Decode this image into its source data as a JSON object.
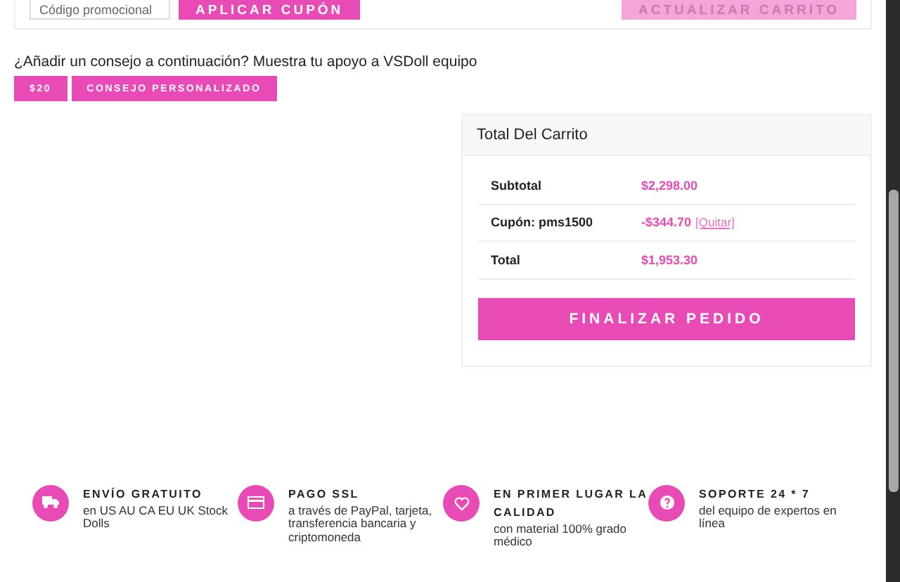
{
  "coupon": {
    "placeholder": "Código promocional",
    "apply_button": "APLICAR CUPÓN",
    "update_button": {
      "label": "ACTUALIZAR CARRITO",
      "disabled": true
    }
  },
  "tip": {
    "prompt": "¿Añadir un consejo a continuación? Muestra tu apoyo a VSDoll equipo",
    "buttons": [
      "$20",
      "CONSEJO PERSONALIZADO"
    ]
  },
  "cart_totals": {
    "title": "Total Del Carrito",
    "rows": [
      {
        "label": "Subtotal",
        "value": "$2,298.00"
      },
      {
        "label": "Cupón: pms1500",
        "value": "-$344.70",
        "link": "[Quitar]"
      },
      {
        "label": "Total",
        "value": "$1,953.30"
      }
    ],
    "checkout_button": "FINALIZAR PEDIDO"
  },
  "features": [
    {
      "kind": "truck",
      "title": "ENVÍO GRATUITO",
      "text": "en US AU CA EU UK Stock Dolls"
    },
    {
      "kind": "card",
      "title": "PAGO SSL",
      "text": "a través de PayPal, tarjeta, transferencia bancaria y criptomoneda"
    },
    {
      "kind": "heart",
      "title": "EN PRIMER LUGAR LA CALIDAD",
      "text": "con material 100% grado médico"
    },
    {
      "kind": "question",
      "title": "SOPORTE 24 * 7",
      "text": "del equipo de expertos en línea"
    }
  ]
}
